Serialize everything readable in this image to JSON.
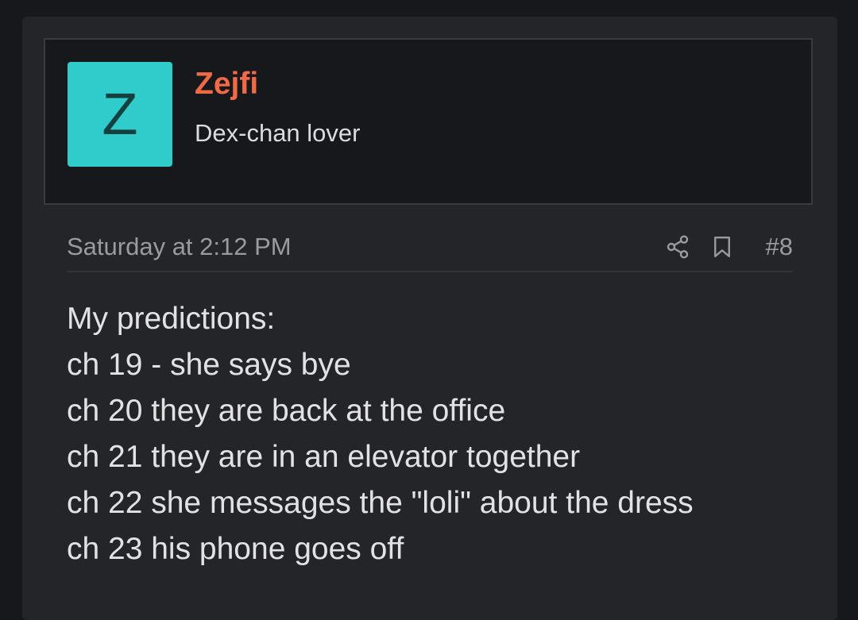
{
  "post": {
    "user": {
      "avatar_letter": "Z",
      "avatar_color": "#30cccc",
      "username": "Zejfi",
      "username_color": "#f06a45",
      "title": "Dex-chan lover"
    },
    "meta": {
      "timestamp": "Saturday at 2:12 PM",
      "share_icon": "share-icon",
      "bookmark_icon": "bookmark-icon",
      "post_number": "#8"
    },
    "body_lines": [
      "My predictions:",
      "ch 19 - she says bye",
      "ch 20 they are back at the office",
      "ch 21 they are in an elevator together",
      "ch 22 she messages the \"loli\" about the dress",
      "ch 23 his phone goes off"
    ]
  }
}
